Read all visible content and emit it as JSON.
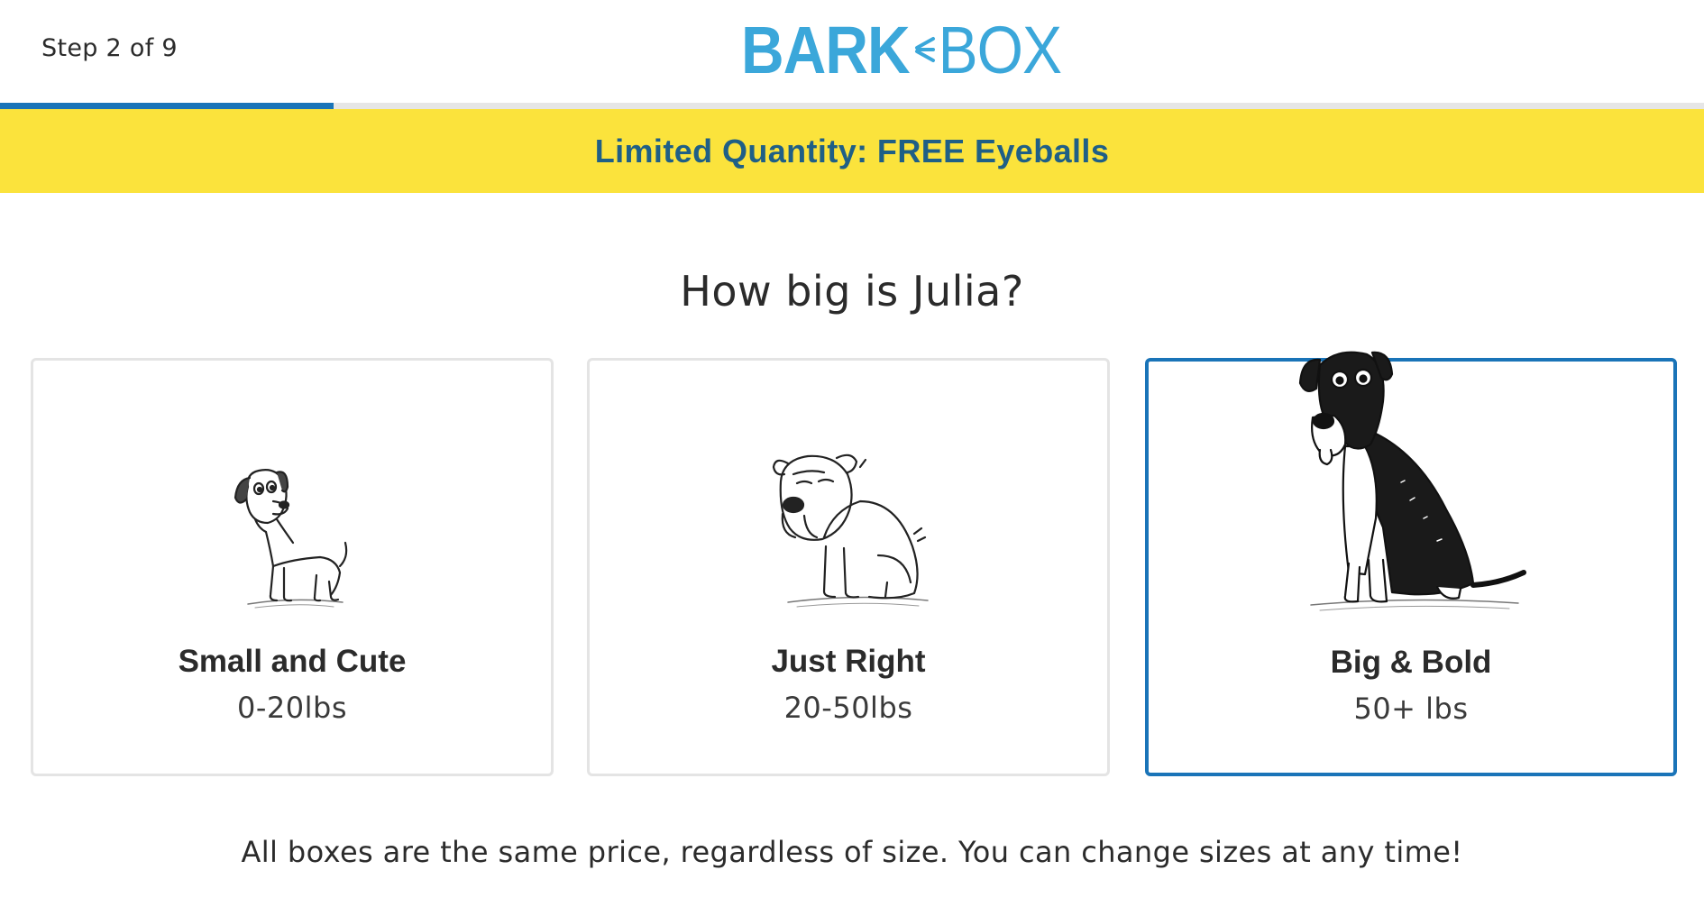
{
  "header": {
    "step_label": "Step 2 of 9",
    "logo": {
      "left_text": "BARK",
      "right_text": "BOX",
      "color": "#3ba7da"
    },
    "progress": {
      "current_step": 2,
      "total_steps": 9,
      "fill_color": "#1a74b8"
    }
  },
  "promo_banner": {
    "text": "Limited Quantity: FREE Eyeballs",
    "background": "#fbe33c",
    "text_color": "#1f5f86"
  },
  "question": "How big is Julia?",
  "size_options": [
    {
      "title": "Small and Cute",
      "range": "0-20lbs",
      "icon": "small-dog-illustration",
      "selected": false
    },
    {
      "title": "Just Right",
      "range": "20-50lbs",
      "icon": "medium-dog-illustration",
      "selected": false
    },
    {
      "title": "Big & Bold",
      "range": "50+ lbs",
      "icon": "large-dog-illustration",
      "selected": true
    }
  ],
  "selected_border_color": "#1a74b8",
  "footnote": "All boxes are the same price, regardless of size. You can change sizes at any time!"
}
